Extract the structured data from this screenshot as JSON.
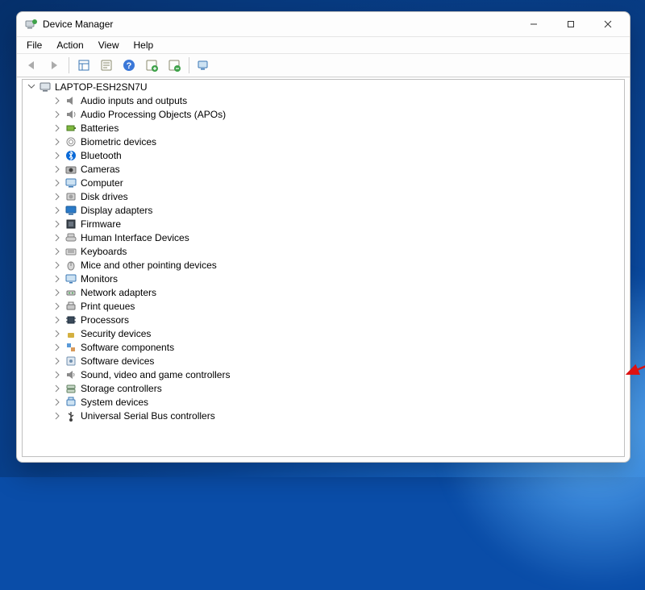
{
  "title": "Device Manager",
  "menus": [
    "File",
    "Action",
    "View",
    "Help"
  ],
  "root": "LAPTOP-ESH2SN7U",
  "categories": [
    {
      "icon": "audio",
      "label": "Audio inputs and outputs"
    },
    {
      "icon": "apo",
      "label": "Audio Processing Objects (APOs)"
    },
    {
      "icon": "battery",
      "label": "Batteries"
    },
    {
      "icon": "biometric",
      "label": "Biometric devices"
    },
    {
      "icon": "bluetooth",
      "label": "Bluetooth"
    },
    {
      "icon": "camera",
      "label": "Cameras"
    },
    {
      "icon": "computer",
      "label": "Computer"
    },
    {
      "icon": "disk",
      "label": "Disk drives"
    },
    {
      "icon": "display",
      "label": "Display adapters"
    },
    {
      "icon": "firmware",
      "label": "Firmware"
    },
    {
      "icon": "hid",
      "label": "Human Interface Devices"
    },
    {
      "icon": "keyboard",
      "label": "Keyboards"
    },
    {
      "icon": "mouse",
      "label": "Mice and other pointing devices"
    },
    {
      "icon": "monitor",
      "label": "Monitors"
    },
    {
      "icon": "network",
      "label": "Network adapters"
    },
    {
      "icon": "print",
      "label": "Print queues"
    },
    {
      "icon": "processor",
      "label": "Processors"
    },
    {
      "icon": "security",
      "label": "Security devices"
    },
    {
      "icon": "swcomp",
      "label": "Software components"
    },
    {
      "icon": "swdev",
      "label": "Software devices"
    },
    {
      "icon": "sound",
      "label": "Sound, video and game controllers"
    },
    {
      "icon": "storage",
      "label": "Storage controllers"
    },
    {
      "icon": "system",
      "label": "System devices"
    },
    {
      "icon": "usb",
      "label": "Universal Serial Bus controllers"
    }
  ],
  "toolbar": [
    {
      "name": "back",
      "enabled": false
    },
    {
      "name": "forward",
      "enabled": false
    },
    {
      "sep": true
    },
    {
      "name": "show-containers",
      "enabled": true
    },
    {
      "name": "properties",
      "enabled": true
    },
    {
      "name": "help",
      "enabled": true
    },
    {
      "name": "update-driver",
      "enabled": true
    },
    {
      "name": "uninstall",
      "enabled": true
    },
    {
      "sep": true
    },
    {
      "name": "scan-hardware",
      "enabled": true
    }
  ],
  "arrow_target_index": 20
}
